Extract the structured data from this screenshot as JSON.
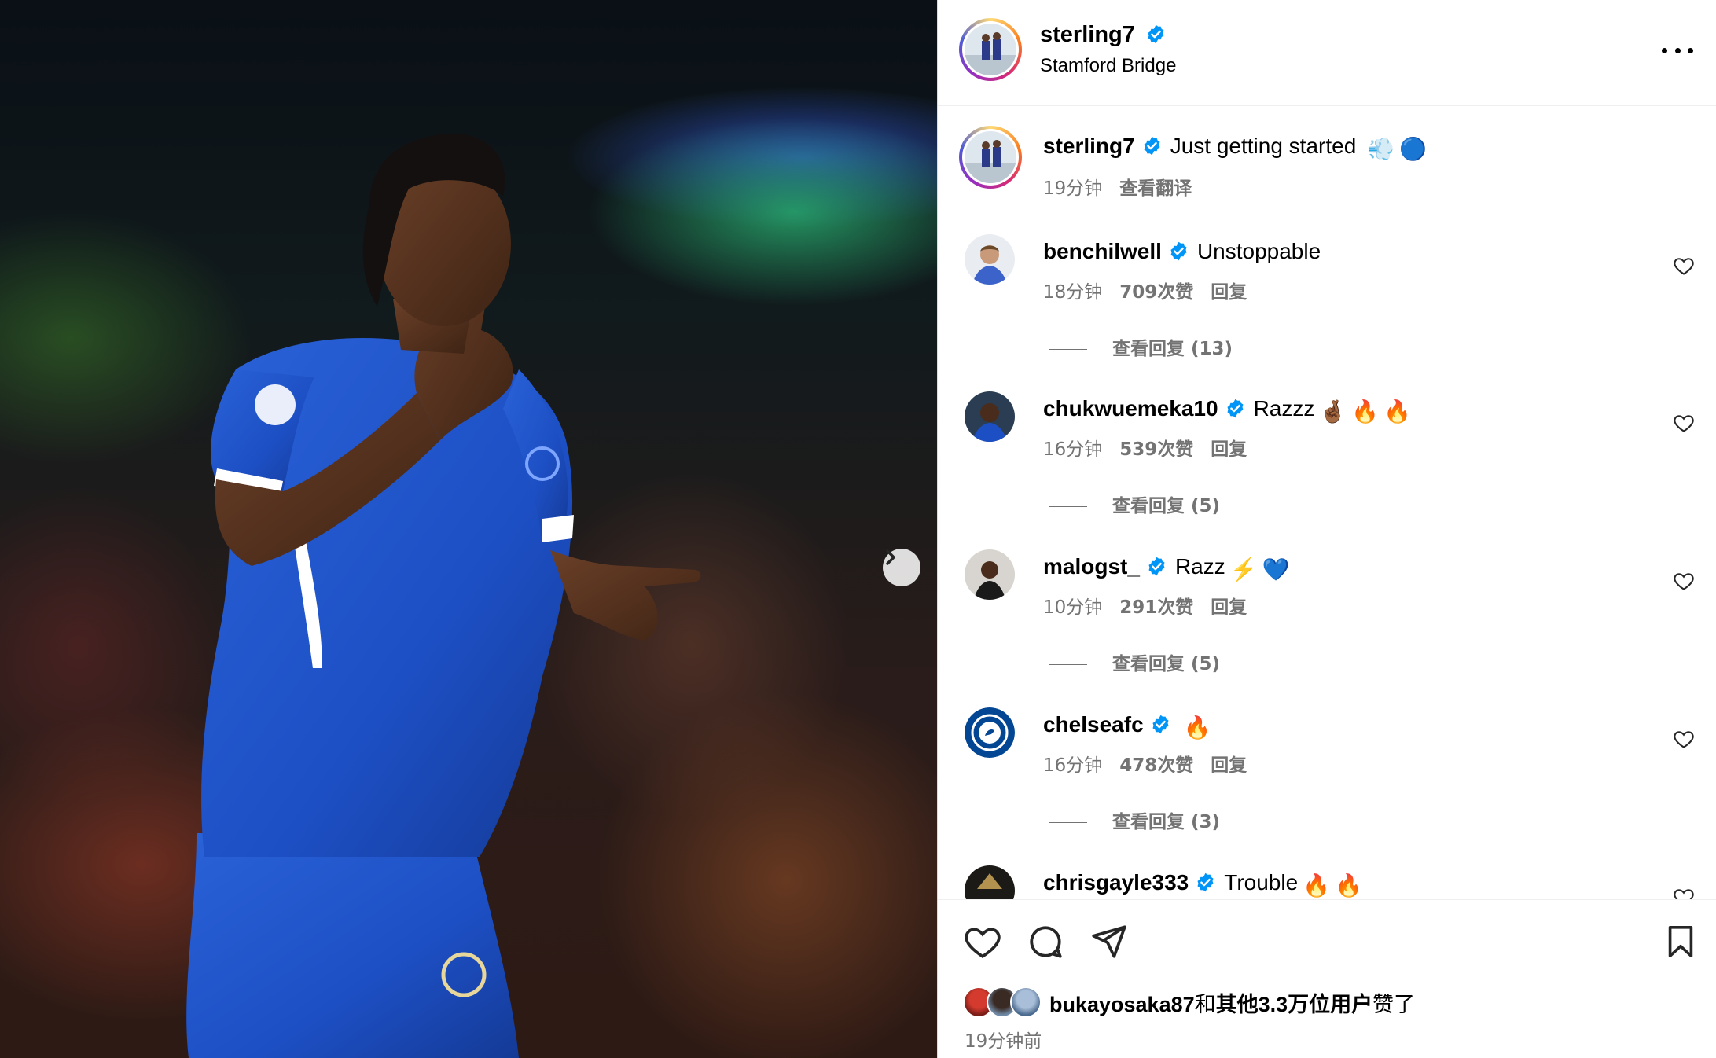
{
  "post": {
    "author": "sterling7",
    "location": "Stamford Bridge",
    "more_icon": "more-horizontal-icon"
  },
  "caption": {
    "username": "sterling7",
    "text": "Just getting started",
    "emoji": [
      "💨",
      "🔵"
    ],
    "time": "19分钟",
    "translate": "查看翻译"
  },
  "comments": [
    {
      "username": "benchilwell",
      "text": "Unstoppable",
      "emoji": [],
      "time": "18分钟",
      "likes": "709次赞",
      "reply": "回复",
      "view_replies": "查看回复 (13)"
    },
    {
      "username": "chukwuemeka10",
      "text": "Razzz",
      "emoji": [
        "🤞🏾",
        "🔥",
        "🔥"
      ],
      "time": "16分钟",
      "likes": "539次赞",
      "reply": "回复",
      "view_replies": "查看回复 (5)"
    },
    {
      "username": "malogst_",
      "text": "Razz",
      "emoji": [
        "⚡",
        "💙"
      ],
      "time": "10分钟",
      "likes": "291次赞",
      "reply": "回复",
      "view_replies": "查看回复 (5)"
    },
    {
      "username": "chelseafc",
      "text": "",
      "emoji": [
        "🔥"
      ],
      "time": "16分钟",
      "likes": "478次赞",
      "reply": "回复",
      "view_replies": "查看回复 (3)"
    },
    {
      "username": "chrisgayle333",
      "text": "Trouble",
      "emoji": [
        "🔥",
        "🔥"
      ]
    }
  ],
  "liked_by": {
    "user": "bukayosaka87",
    "joiner": "和",
    "others": "其他3.3万位用户",
    "suffix": "赞了"
  },
  "posted_time": "19分钟前",
  "colors": {
    "verified": "#0095f6",
    "secondary_text": "#737373",
    "jersey_blue": "#1d4fc4"
  }
}
